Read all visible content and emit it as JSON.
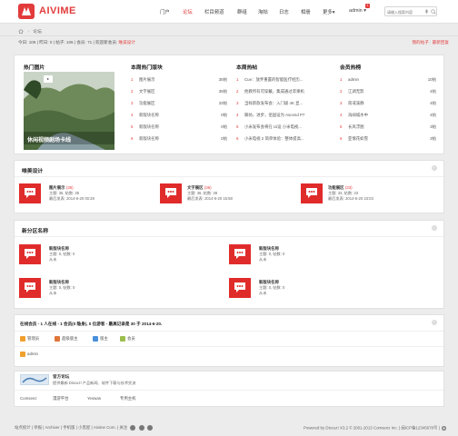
{
  "brand": {
    "name": "AIVIME",
    "color": "#e23b3b"
  },
  "nav": {
    "items": [
      "门户",
      "论坛",
      "栏目频道",
      "群组",
      "淘帖",
      "日志",
      "相册",
      "更多"
    ],
    "active_index": 1,
    "more_arrow": "▾",
    "user": "admin",
    "user_arrow": "▾",
    "notice_count": "1"
  },
  "search": {
    "placeholder": "请输入搜索内容"
  },
  "breadcrumb": {
    "home_icon": "home-icon",
    "sep": "›",
    "current": "论坛"
  },
  "stats": {
    "text": "今日: 106 | 昨日: 0 | 帖子: 106 | 会员: 71 | 欢迎新会员:",
    "newest_member": "唯美设计"
  },
  "top_links": [
    "我的帖子",
    "最新回复"
  ],
  "feature": {
    "hot_images_title": "热门图片",
    "image_caption": "休闲视频剧场卡线",
    "forum_week_title": "本周热门版块",
    "forum_week": [
      {
        "num": "1",
        "name": "图片展示",
        "val": "35帖"
      },
      {
        "num": "2",
        "name": "文字展区",
        "val": "35帖"
      },
      {
        "num": "3",
        "name": "功能展区",
        "val": "33帖"
      },
      {
        "num": "4",
        "name": "新版块名称",
        "val": "0帖"
      },
      {
        "num": "5",
        "name": "新版块名称",
        "val": "0帖"
      },
      {
        "num": "6",
        "name": "新版块名称",
        "val": "0帖"
      }
    ],
    "hot_posts_title": "本周热帖",
    "hot_posts": [
      {
        "num": "1",
        "title": "Cue：放弃重置的智能医疗经历..."
      },
      {
        "num": "2",
        "title": "他教所有可穿戴，集成通过苹果机"
      },
      {
        "num": "3",
        "title": "当样新款发布会：入门级 4K 显..."
      },
      {
        "num": "4",
        "title": "聊坊，进步，佰固设为 Ascend P7"
      },
      {
        "num": "5",
        "title": "小米发布会将在 Ui设 小米电视..."
      },
      {
        "num": "6",
        "title": "小米电视 2 简单体验：整体提高..."
      }
    ],
    "members_title": "会员热榜",
    "members": [
      {
        "num": "1",
        "name": "admin",
        "val": "10帖"
      },
      {
        "num": "2",
        "name": "江湖无影",
        "val": "4帖"
      },
      {
        "num": "3",
        "name": "简戒溪静",
        "val": "4帖"
      },
      {
        "num": "4",
        "name": "海阔城水中",
        "val": "4帖"
      },
      {
        "num": "5",
        "name": "长风浮图",
        "val": "3帖"
      },
      {
        "num": "6",
        "name": "亚情花如雪",
        "val": "3帖"
      }
    ]
  },
  "group1": {
    "title": "唯美设计",
    "forums": [
      {
        "name": "图片展示",
        "count": "(35)",
        "themes": "主题: 35, 帖数: 35",
        "last": "最后发表: 2014-6-20 00:28"
      },
      {
        "name": "文字展区",
        "count": "(36)",
        "themes": "主题: 36, 帖数: 38",
        "last": "最后发表: 2014-6-20 15:58"
      },
      {
        "name": "功能展区",
        "count": "(33)",
        "themes": "主题: 33, 帖数: 33",
        "last": "最后发表: 2014-6-20 23:03"
      }
    ]
  },
  "group2": {
    "title": "新分区名称",
    "forums": [
      {
        "name": "新版块名称",
        "themes": "主题: 0, 帖数: 0",
        "last": "从未"
      },
      {
        "name": "新版块名称",
        "themes": "主题: 0, 帖数: 0",
        "last": "从未"
      },
      {
        "name": "新版块名称",
        "themes": "主题: 0, 帖数: 0",
        "last": "从未"
      },
      {
        "name": "新版块名称",
        "themes": "主题: 0, 帖数: 0",
        "last": "从未"
      }
    ]
  },
  "online": {
    "summary": "在线会员 - 1 人在线 - 1 会员(0 隐身), 0 位游客 - 最高记录是 30 于 2014-6-20.",
    "legend": [
      {
        "label": "管理员",
        "color": "#f0a030"
      },
      {
        "label": "超级版主",
        "color": "#e0763a"
      },
      {
        "label": "版主",
        "color": "#4a90d9"
      },
      {
        "label": "会员",
        "color": "#9bbd4c"
      }
    ],
    "user": "admin"
  },
  "friend_links": {
    "title": "官方论坛",
    "desc": "提供最新 Discuz! 产品新闻、软件下载与技术交流",
    "links": [
      "Comsenz",
      "漫游平台",
      "Yeswan",
      "专用主机"
    ]
  },
  "footer": {
    "left": [
      "站点统计",
      "举报",
      "Archiver",
      "手机版",
      "小黑屋",
      "Aivime Com."
    ],
    "left_extra": "关注",
    "right": "Powered by Discuz! X3.2 © 2001-2013 Comsenz Inc. | 闽ICP备12345678号 |"
  }
}
